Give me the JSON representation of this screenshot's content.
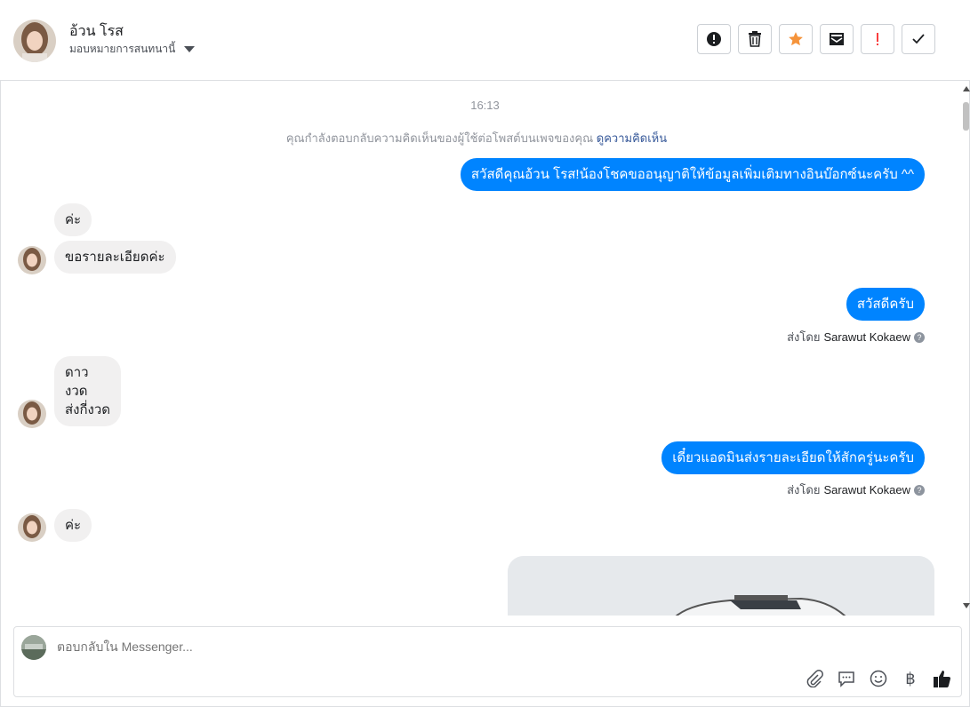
{
  "header": {
    "name": "อ้วน โรส",
    "assign_label": "มอบหมายการสนทนานี้",
    "actions": [
      {
        "icon": "alert-icon"
      },
      {
        "icon": "trash-icon"
      },
      {
        "icon": "star-icon",
        "color": "#f5933a"
      },
      {
        "icon": "mark-unread-icon"
      },
      {
        "icon": "exclamation-icon",
        "color": "#fa3e3e"
      },
      {
        "icon": "check-icon"
      }
    ]
  },
  "thread": {
    "time": "16:13",
    "notice_text": "คุณกำลังตอบกลับความคิดเห็นของผู้ใช้ต่อโพสต์บนเพจของคุณ",
    "notice_link": "ดูความคิดเห็น",
    "messages": [
      {
        "dir": "out",
        "text": "สวัสดีคุณอ้วน โรส!น้องโชคขออนุญาติให้ข้อมูลเพิ่มเติมทางอินบ๊อกซ์นะครับ ^^"
      },
      {
        "dir": "in",
        "text": "ค่ะ"
      },
      {
        "dir": "in",
        "text": "ขอรายละเอียดค่ะ"
      },
      {
        "dir": "out",
        "text": "สวัสดีครับ"
      },
      {
        "dir": "in",
        "lines": [
          "ดาว",
          "งวด",
          "ส่งกี่งวด"
        ]
      },
      {
        "dir": "out",
        "text": "เดี๋ยวแอดมินส่งรายละเอียดให้สักครู่นะครับ"
      },
      {
        "dir": "in",
        "text": "ค่ะ"
      }
    ],
    "sent_by_label": "ส่งโดย",
    "sent_by_name": "Sarawut Kokaew",
    "help_glyph": "?"
  },
  "composer": {
    "placeholder": "ตอบกลับใน Messenger...",
    "tools": [
      "paperclip-icon",
      "chat-bubble-icon",
      "emoji-icon",
      "baht-icon",
      "thumbs-up-icon"
    ],
    "baht_glyph": "฿"
  },
  "colors": {
    "outgoing": "#0084ff",
    "incoming": "#f1f0f0",
    "link": "#365899"
  }
}
